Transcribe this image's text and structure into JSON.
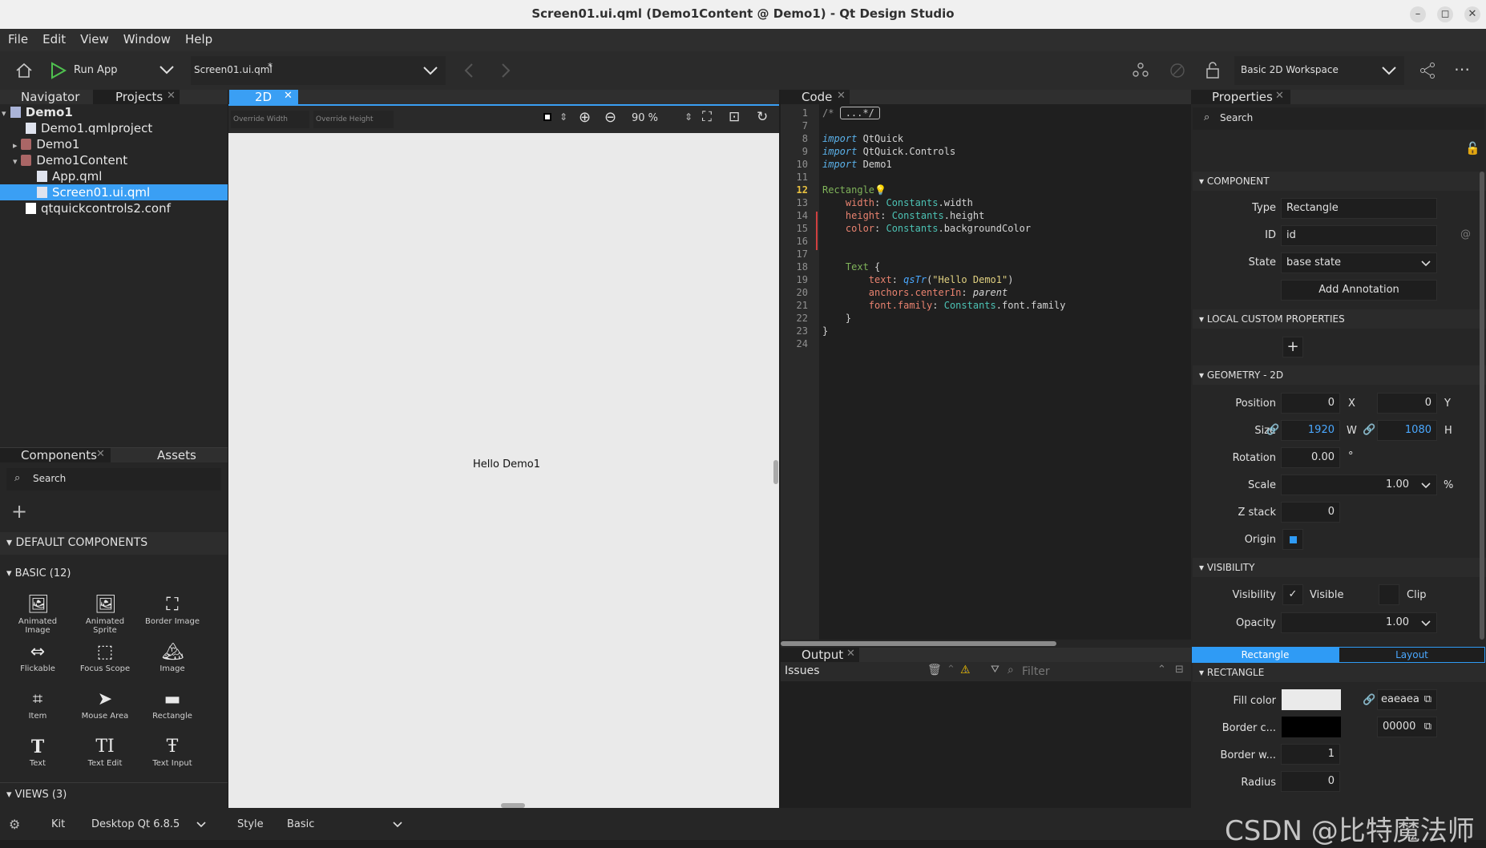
{
  "window": {
    "title": "Screen01.ui.qml (Demo1Content @ Demo1) - Qt Design Studio",
    "minimize": "–",
    "maximize": "◻",
    "close": "✕"
  },
  "menu": [
    "File",
    "Edit",
    "View",
    "Window",
    "Help"
  ],
  "toolbar": {
    "run_label": "Run App",
    "file_combo": "Screen01.ui.qml",
    "file_modified": "*",
    "workspace": "Basic 2D Workspace"
  },
  "left": {
    "tabs": [
      "Navigator",
      "Projects"
    ],
    "tree": [
      {
        "label": "Demo1",
        "depth": 0,
        "expanded": "▾"
      },
      {
        "label": "Demo1.qmlproject",
        "depth": 1
      },
      {
        "label": "Demo1",
        "depth": 1,
        "expanded": "▸"
      },
      {
        "label": "Demo1Content",
        "depth": 1,
        "expanded": "▾"
      },
      {
        "label": "App.qml",
        "depth": 2
      },
      {
        "label": "Screen01.ui.qml",
        "depth": 2,
        "selected": true
      },
      {
        "label": "qtquickcontrols2.conf",
        "depth": 1
      }
    ],
    "lower_tabs": [
      "Components",
      "Assets"
    ],
    "search_placeholder": "Search",
    "default_components": "DEFAULT COMPONENTS",
    "basic_section": "BASIC (12)",
    "components": [
      "Animated Image",
      "Animated Sprite",
      "Border Image",
      "Flickable",
      "Focus Scope",
      "Image",
      "Item",
      "Mouse Area",
      "Rectangle",
      "Text",
      "Text Edit",
      "Text Input"
    ],
    "views_section": "VIEWS (3)"
  },
  "canvas": {
    "tab": "2D",
    "override_width": "Override Width",
    "override_height": "Override Height",
    "zoom": "90 %",
    "text": "Hello Demo1"
  },
  "code": {
    "tab": "Code",
    "lines": [
      {
        "n": "1",
        "html": "<span style='color:#909090'>/* </span><span style='border:1px solid #bbb;border-radius:3px;padding:0 6px;color:#ccc'>...*/</span>"
      },
      {
        "n": "7",
        "html": ""
      },
      {
        "n": "8",
        "html": "<span class='kw'>import</span> QtQuick"
      },
      {
        "n": "9",
        "html": "<span class='kw'>import</span> QtQuick.Controls"
      },
      {
        "n": "10",
        "html": "<span class='kw'>import</span> Demo1"
      },
      {
        "n": "11",
        "html": ""
      },
      {
        "n": "12",
        "html": "<span class='ty'>Rectangle</span><span style='color:#e8c040'>💡</span>"
      },
      {
        "n": "13",
        "html": "    <span class='pr'>width</span>: <span class='cs'>Constants</span>.width"
      },
      {
        "n": "14",
        "html": "    <span class='pr'>height</span>: <span class='cs'>Constants</span>.height"
      },
      {
        "n": "15",
        "html": "    <span class='pr'>color</span>: <span class='cs'>Constants</span>.backgroundColor"
      },
      {
        "n": "16",
        "html": ""
      },
      {
        "n": "17",
        "html": ""
      },
      {
        "n": "18",
        "html": "    <span class='ty'>Text</span> {"
      },
      {
        "n": "19",
        "html": "        <span class='pr'>text</span>: <span class='fn'>qsTr</span>(<span class='st'>\"Hello Demo1\"</span>)"
      },
      {
        "n": "20",
        "html": "        <span class='pr'>anchors.centerIn</span>: <i>parent</i>"
      },
      {
        "n": "21",
        "html": "        <span class='pr'>font.family</span>: <span class='cs'>Constants</span>.font.family"
      },
      {
        "n": "22",
        "html": "    }"
      },
      {
        "n": "23",
        "html": "}"
      },
      {
        "n": "24",
        "html": ""
      }
    ]
  },
  "output": {
    "tab": "Output",
    "issues": "Issues",
    "filter_placeholder": "Filter"
  },
  "properties": {
    "tab": "Properties",
    "search_placeholder": "Search",
    "component_section": "COMPONENT",
    "type_label": "Type",
    "type_value": "Rectangle",
    "id_label": "ID",
    "id_value": "id",
    "state_label": "State",
    "state_value": "base state",
    "add_annotation": "Add Annotation",
    "local_custom": "LOCAL CUSTOM PROPERTIES",
    "geometry_section": "GEOMETRY - 2D",
    "position_label": "Position",
    "pos_x": "0",
    "pos_y": "0",
    "x_axis": "X",
    "y_axis": "Y",
    "size_label": "Size",
    "size_w": "1920",
    "size_h": "1080",
    "w_axis": "W",
    "h_axis": "H",
    "rotation_label": "Rotation",
    "rotation": "0.00",
    "deg": "°",
    "scale_label": "Scale",
    "scale": "1.00",
    "pct": "%",
    "zstack_label": "Z stack",
    "zstack": "0",
    "origin_label": "Origin",
    "visibility_section": "VISIBILITY",
    "visibility_label": "Visibility",
    "visible_label": "Visible",
    "clip_label": "Clip",
    "opacity_label": "Opacity",
    "opacity": "1.00",
    "tab_rect": "Rectangle",
    "tab_layout": "Layout",
    "rectangle_section": "RECTANGLE",
    "fill_label": "Fill color",
    "fill_value": "eaeaea",
    "border_color_label": "Border c...",
    "border_color_value": "00000",
    "border_w_label": "Border w...",
    "border_w": "1",
    "radius_label": "Radius",
    "radius": "0"
  },
  "status": {
    "kit_label": "Kit",
    "kit_value": "Desktop Qt 6.8.5",
    "style_label": "Style",
    "style_value": "Basic"
  },
  "watermark": "CSDN @比特魔法师",
  "colors": {
    "accent": "#2f9bf5",
    "selection": "#3a9ff4",
    "canvas": "#eaeaea"
  }
}
